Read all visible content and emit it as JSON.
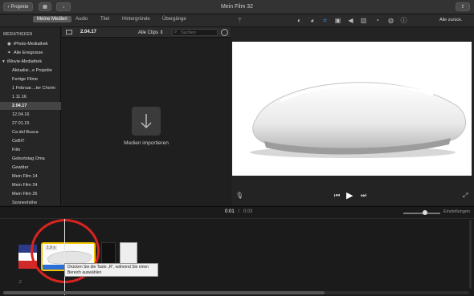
{
  "window": {
    "title": "Mein Film 32",
    "projects_button": "Projekte"
  },
  "tabs": [
    {
      "label": "Meine Medien",
      "active": true
    },
    {
      "label": "Audio",
      "active": false
    },
    {
      "label": "Titel",
      "active": false
    },
    {
      "label": "Hintergründe",
      "active": false
    },
    {
      "label": "Übergänge",
      "active": false
    }
  ],
  "viewer_toolbar": {
    "reset_all": "Alle zurück."
  },
  "sidebar": {
    "libraries_header": "MEDIATHEKEN",
    "items": [
      {
        "label": "iPhoto-Mediathek",
        "level": 1,
        "selected": false
      },
      {
        "label": "Alle Ereignisse",
        "level": 1,
        "selected": false
      },
      {
        "label": "iMovie-Mediathek",
        "level": 0,
        "selected": false
      },
      {
        "label": "Aktualisi...e Projekte",
        "level": 2,
        "selected": false
      },
      {
        "label": "Fertige Filme",
        "level": 2,
        "selected": false
      },
      {
        "label": "1 Februar....ter Chorin",
        "level": 2,
        "selected": false
      },
      {
        "label": "1.11.16",
        "level": 2,
        "selected": false
      },
      {
        "label": "2.04.17",
        "level": 2,
        "selected": true
      },
      {
        "label": "12.04.16",
        "level": 2,
        "selected": false
      },
      {
        "label": "27.01.15",
        "level": 2,
        "selected": false
      },
      {
        "label": "Ca del Busca",
        "level": 2,
        "selected": false
      },
      {
        "label": "CeBIT",
        "level": 2,
        "selected": false
      },
      {
        "label": "Film",
        "level": 2,
        "selected": false
      },
      {
        "label": "Geburtstag Oma",
        "level": 2,
        "selected": false
      },
      {
        "label": "Gewitter",
        "level": 2,
        "selected": false
      },
      {
        "label": "Mein Film 14",
        "level": 2,
        "selected": false
      },
      {
        "label": "Mein Film 24",
        "level": 2,
        "selected": false
      },
      {
        "label": "Mein Film 25",
        "level": 2,
        "selected": false
      },
      {
        "label": "Sonnenhöhe",
        "level": 2,
        "selected": false
      }
    ]
  },
  "browser": {
    "event_title": "2.04.17",
    "filter": "Alle Clips",
    "search_placeholder": "Suchen",
    "import_label": "Medien importieren"
  },
  "playback": {
    "current_time": "0:01",
    "separator": "/",
    "total_time": "0:03"
  },
  "timeline": {
    "settings_label": "Einstellungen",
    "clip_duration": "1,9 s",
    "tooltip": "Drücken Sie die Taste „R“, während Sie einen Bereich auswählen"
  },
  "colors": {
    "highlight_circle": "#d9231e",
    "selected_clip_border": "#f5c400",
    "accent_blue": "#2a6fd6"
  }
}
